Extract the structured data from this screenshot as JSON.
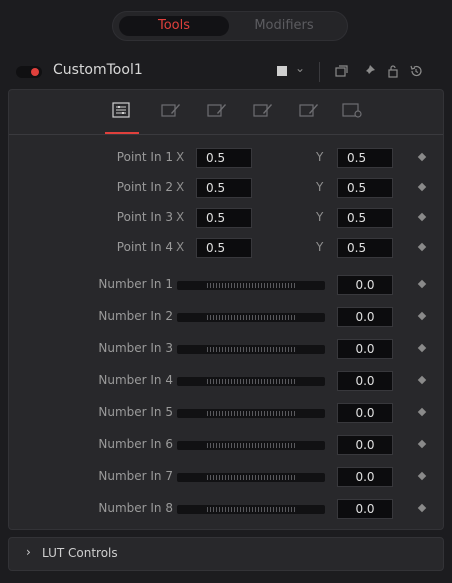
{
  "top_tabs": {
    "tools": "Tools",
    "modifiers": "Modifiers",
    "active": "tools"
  },
  "tool": {
    "name": "CustomTool1",
    "enabled": true
  },
  "colors": {
    "accent": "#e0403c",
    "panel_bg": "#28282b",
    "window_bg": "#1c1c1f"
  },
  "header_icons": [
    "color-swatch-icon",
    "chevron-down-icon",
    "copy-icon",
    "pin-icon",
    "lock-icon",
    "reset-icon"
  ],
  "panel_tabs": [
    {
      "icon": "controls-icon",
      "active": true
    },
    {
      "icon": "edit-icon",
      "active": false
    },
    {
      "icon": "edit-icon",
      "active": false
    },
    {
      "icon": "edit-icon",
      "active": false
    },
    {
      "icon": "edit-icon",
      "active": false
    },
    {
      "icon": "settings-icon",
      "active": false
    }
  ],
  "points": [
    {
      "label": "Point In 1",
      "x_label": "X",
      "x": "0.5",
      "y_label": "Y",
      "y": "0.5"
    },
    {
      "label": "Point In 2",
      "x_label": "X",
      "x": "0.5",
      "y_label": "Y",
      "y": "0.5"
    },
    {
      "label": "Point In 3",
      "x_label": "X",
      "x": "0.5",
      "y_label": "Y",
      "y": "0.5"
    },
    {
      "label": "Point In 4",
      "x_label": "X",
      "x": "0.5",
      "y_label": "Y",
      "y": "0.5"
    }
  ],
  "numbers": [
    {
      "label": "Number In 1",
      "value": "0.0"
    },
    {
      "label": "Number In 2",
      "value": "0.0"
    },
    {
      "label": "Number In 3",
      "value": "0.0"
    },
    {
      "label": "Number In 4",
      "value": "0.0"
    },
    {
      "label": "Number In 5",
      "value": "0.0"
    },
    {
      "label": "Number In 6",
      "value": "0.0"
    },
    {
      "label": "Number In 7",
      "value": "0.0"
    },
    {
      "label": "Number In 8",
      "value": "0.0"
    }
  ],
  "lut_section": {
    "label": "LUT Controls",
    "expanded": false
  }
}
